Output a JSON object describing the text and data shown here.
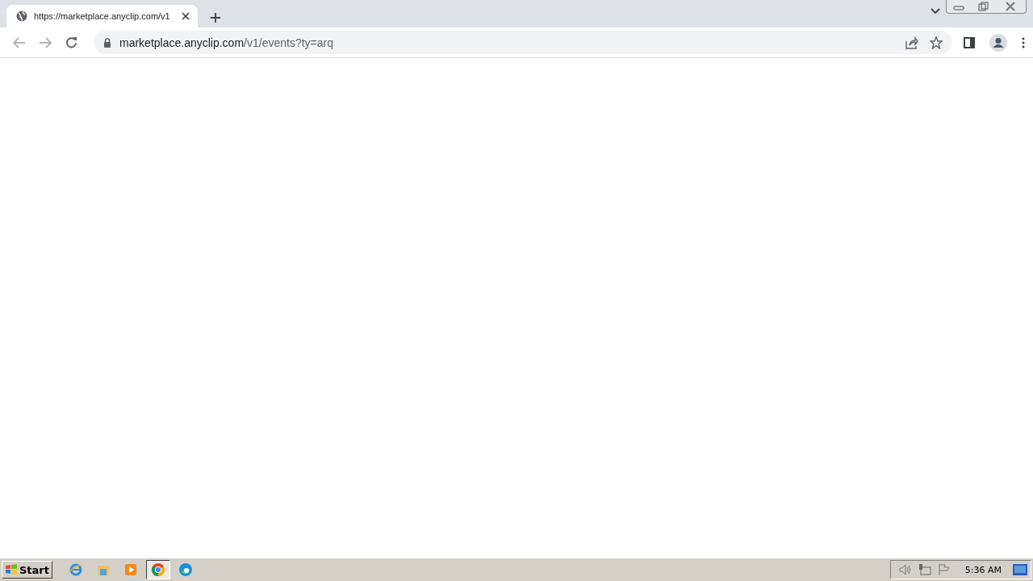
{
  "tabs": [
    {
      "title": "https://marketplace.anyclip.com/v1",
      "selected": true
    }
  ],
  "address_bar": {
    "host": "marketplace.anyclip.com",
    "path": "/v1/events?ty=arq"
  },
  "taskbar": {
    "start": "Start",
    "apps": [
      {
        "kind": "ie",
        "selected": false
      },
      {
        "kind": "explorer",
        "selected": false
      },
      {
        "kind": "media",
        "selected": false
      },
      {
        "kind": "chrome",
        "selected": true
      },
      {
        "kind": "edge",
        "selected": false
      }
    ],
    "clock": "5:36 AM"
  }
}
